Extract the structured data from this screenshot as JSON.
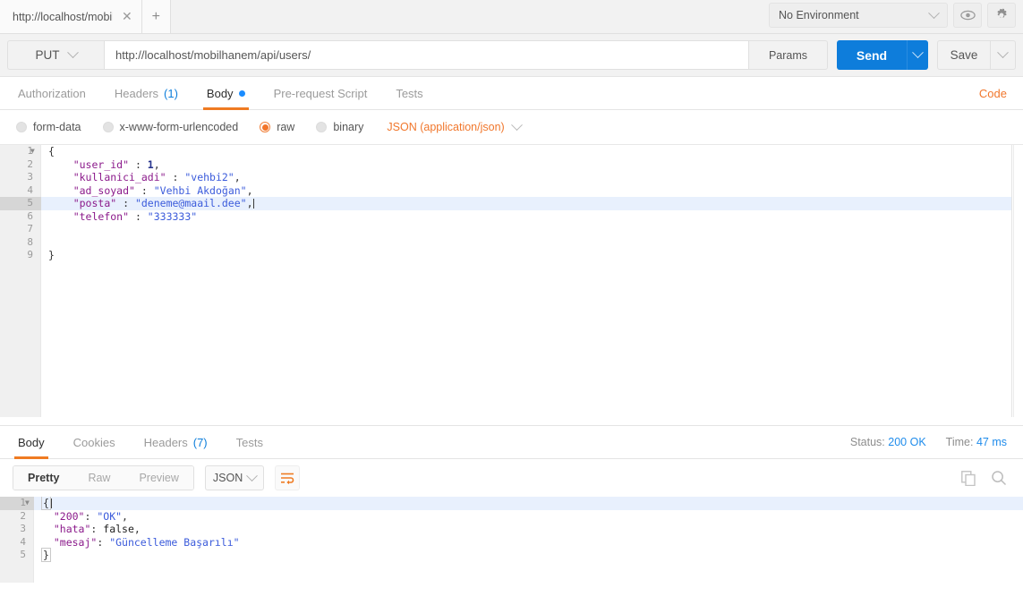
{
  "tabbar": {
    "request_tab_title": "http://localhost/mobil",
    "close_label": "✕",
    "new_tab_label": "+",
    "environment": "No Environment",
    "eye_icon": "eye-icon",
    "gear_icon": "gear-icon"
  },
  "urlbar": {
    "method": "PUT",
    "url": "http://localhost/mobilhanem/api/users/",
    "params_label": "Params",
    "send_label": "Send",
    "save_label": "Save"
  },
  "request_tabs": {
    "items": [
      {
        "label": "Authorization",
        "count": "",
        "active": false
      },
      {
        "label": "Headers",
        "count": "(1)",
        "active": false
      },
      {
        "label": "Body",
        "count": "",
        "active": true
      },
      {
        "label": "Pre-request Script",
        "count": "",
        "active": false
      },
      {
        "label": "Tests",
        "count": "",
        "active": false
      }
    ],
    "code_link": "Code"
  },
  "body_type": {
    "options": [
      {
        "label": "form-data",
        "selected": false
      },
      {
        "label": "x-www-form-urlencoded",
        "selected": false
      },
      {
        "label": "raw",
        "selected": true
      },
      {
        "label": "binary",
        "selected": false
      }
    ],
    "content_type": "JSON (application/json)"
  },
  "request_body": {
    "lines": [
      {
        "no": "1",
        "fold": true,
        "highlight": false,
        "tokens": [
          {
            "t": "{",
            "c": "pun"
          }
        ]
      },
      {
        "no": "2",
        "fold": false,
        "highlight": false,
        "tokens": [
          {
            "t": "    ",
            "c": "pun"
          },
          {
            "t": "\"user_id\"",
            "c": "key"
          },
          {
            "t": " : ",
            "c": "pun"
          },
          {
            "t": "1",
            "c": "num"
          },
          {
            "t": ",",
            "c": "pun"
          }
        ]
      },
      {
        "no": "3",
        "fold": false,
        "highlight": false,
        "tokens": [
          {
            "t": "    ",
            "c": "pun"
          },
          {
            "t": "\"kullanici_adi\"",
            "c": "key"
          },
          {
            "t": " : ",
            "c": "pun"
          },
          {
            "t": "\"vehbi2\"",
            "c": "str"
          },
          {
            "t": ",",
            "c": "pun"
          }
        ]
      },
      {
        "no": "4",
        "fold": false,
        "highlight": false,
        "tokens": [
          {
            "t": "    ",
            "c": "pun"
          },
          {
            "t": "\"ad_soyad\"",
            "c": "key"
          },
          {
            "t": " : ",
            "c": "pun"
          },
          {
            "t": "\"Vehbi Akdoğan\"",
            "c": "str"
          },
          {
            "t": ",",
            "c": "pun"
          }
        ]
      },
      {
        "no": "5",
        "fold": false,
        "highlight": true,
        "caret": true,
        "tokens": [
          {
            "t": "    ",
            "c": "pun"
          },
          {
            "t": "\"posta\"",
            "c": "key"
          },
          {
            "t": " : ",
            "c": "pun"
          },
          {
            "t": "\"deneme@maail.dee\"",
            "c": "str"
          },
          {
            "t": ",",
            "c": "pun"
          }
        ]
      },
      {
        "no": "6",
        "fold": false,
        "highlight": false,
        "tokens": [
          {
            "t": "    ",
            "c": "pun"
          },
          {
            "t": "\"telefon\"",
            "c": "key"
          },
          {
            "t": " : ",
            "c": "pun"
          },
          {
            "t": "\"333333\"",
            "c": "str"
          }
        ]
      },
      {
        "no": "7",
        "fold": false,
        "highlight": false,
        "tokens": []
      },
      {
        "no": "8",
        "fold": false,
        "highlight": false,
        "tokens": []
      },
      {
        "no": "9",
        "fold": false,
        "highlight": false,
        "tokens": [
          {
            "t": "}",
            "c": "pun"
          }
        ]
      }
    ]
  },
  "response_tabs": {
    "items": [
      {
        "label": "Body",
        "count": "",
        "active": true
      },
      {
        "label": "Cookies",
        "count": "",
        "active": false
      },
      {
        "label": "Headers",
        "count": "(7)",
        "active": false
      },
      {
        "label": "Tests",
        "count": "",
        "active": false
      }
    ],
    "status_label": "Status:",
    "status_value": "200 OK",
    "time_label": "Time:",
    "time_value": "47 ms"
  },
  "response_toolbar": {
    "view_modes": [
      {
        "label": "Pretty",
        "active": true
      },
      {
        "label": "Raw",
        "active": false
      },
      {
        "label": "Preview",
        "active": false
      }
    ],
    "format": "JSON",
    "wrap_icon": "word-wrap-icon",
    "copy_icon": "copy-icon",
    "search_icon": "search-icon"
  },
  "response_body": {
    "lines": [
      {
        "no": "1",
        "fold": true,
        "highlight": true,
        "caret": true,
        "box": true,
        "tokens": [
          {
            "t": "{",
            "c": "pun"
          }
        ]
      },
      {
        "no": "2",
        "fold": false,
        "highlight": false,
        "tokens": [
          {
            "t": "  ",
            "c": "pun"
          },
          {
            "t": "\"200\"",
            "c": "key"
          },
          {
            "t": ": ",
            "c": "pun"
          },
          {
            "t": "\"OK\"",
            "c": "str"
          },
          {
            "t": ",",
            "c": "pun"
          }
        ]
      },
      {
        "no": "3",
        "fold": false,
        "highlight": false,
        "tokens": [
          {
            "t": "  ",
            "c": "pun"
          },
          {
            "t": "\"hata\"",
            "c": "key"
          },
          {
            "t": ": ",
            "c": "pun"
          },
          {
            "t": "false",
            "c": "bool"
          },
          {
            "t": ",",
            "c": "pun"
          }
        ]
      },
      {
        "no": "4",
        "fold": false,
        "highlight": false,
        "tokens": [
          {
            "t": "  ",
            "c": "pun"
          },
          {
            "t": "\"mesaj\"",
            "c": "key"
          },
          {
            "t": ": ",
            "c": "pun"
          },
          {
            "t": "\"Güncelleme Başarılı\"",
            "c": "str"
          }
        ]
      },
      {
        "no": "5",
        "fold": false,
        "highlight": false,
        "box": true,
        "tokens": [
          {
            "t": "}",
            "c": "pun"
          }
        ]
      }
    ]
  },
  "colors": {
    "accent_orange": "#ef7b22",
    "send_blue": "#0e7ddb",
    "link_blue": "#1f8ceb",
    "json_key": "#8b1a8b",
    "json_string": "#3b5bdb"
  }
}
